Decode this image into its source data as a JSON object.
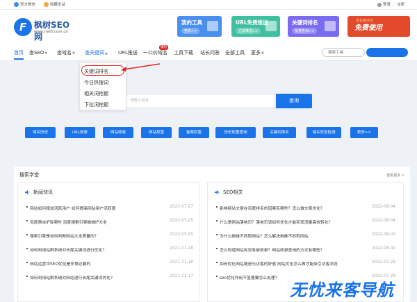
{
  "topbar": {
    "official_wechat": "官方微信",
    "favorite": "收藏本站",
    "login": "登录",
    "separator": "|",
    "register": "注册"
  },
  "logo": {
    "brand": "枫树SEO网",
    "url": "www.md5.com.cn"
  },
  "banners": [
    {
      "title": "我的工具",
      "sub": "查看>>",
      "color": "#4a8ff0"
    },
    {
      "title": "URL免费推送",
      "sub": "立即推送>>",
      "color": "#3fc0a0"
    },
    {
      "title": "关键词排名",
      "sub": "批量查询>>",
      "color": "#7a6cf0"
    },
    {
      "title": "免费使用",
      "sub": "企业级SEO",
      "color": "#e24a2b"
    }
  ],
  "nav": {
    "items": [
      "首页",
      "查SEO",
      "查域名",
      "查关键词",
      "URL推送",
      "一口价域名",
      "工具下载",
      "站长问答",
      "全部工具",
      "更多"
    ],
    "hot_badge": "爆热",
    "search_placeholder": "搜索工具"
  },
  "dropdown": {
    "items": [
      "关键词排名",
      "今日热搜词",
      "相关词挖掘",
      "下拉词挖掘"
    ]
  },
  "hero": {
    "placeholder": "请输入网址",
    "button": "查询"
  },
  "quick_tools": [
    "域名历史",
    "URL收录",
    "网站收录",
    "网站权重",
    "备案权重",
    "历史权重查询",
    "关键词排名",
    "域名安全检测",
    "更多>>"
  ],
  "learning": {
    "title": "搜索学堂",
    "more": "查看更多 >",
    "news": {
      "title": "新闻快讯",
      "rows": [
        {
          "text": "网站如何增加活跃用户 如何提高网站用户活跃度",
          "date": "2022-07-27"
        },
        {
          "text": "百度爬虫IP有哪些 百度搜索引擎蜘蛛IP大全",
          "date": "2022-07-25"
        },
        {
          "text": "搜索引擎是如何判断网站文本质量的？",
          "date": "2022-05-05"
        },
        {
          "text": "如何利用站群系统对长尾关键词进行优化？",
          "date": "2021-11-18"
        },
        {
          "text": "网站运营中SEO优化是非常必要的",
          "date": "2021-11-18"
        },
        {
          "text": "如何利用站群系统对网站进行长尾关键词优化？",
          "date": "2021-11-17"
        }
      ]
    },
    "seo": {
      "title": "SEO相关",
      "rows": [
        {
          "text": "影响网站文章在百度排名的因素有哪些？怎么做文章优化？",
          "date": "2022-08-04"
        },
        {
          "text": "什么是网站落地页？落地页该如何优化才能实现流量高效转化？",
          "date": "2022-08-04"
        },
        {
          "text": "为什么蜘蛛不抓取网站？怎么解决蜘蛛不抓取网站",
          "date": "2022-08-03"
        },
        {
          "text": "怎么知道网站有没有被收录？网站收录查询的方式有哪些？",
          "date": "2022-08-02"
        },
        {
          "text": "如何优化网站增进与访客的好感 网站优化怎么做才能吸引访客浏览",
          "date": "2022-07-29"
        },
        {
          "text": "seo优化作用不显著要怎么处理？",
          "date": "2022-07-29"
        }
      ]
    }
  },
  "watermark": "无忧来客导航"
}
